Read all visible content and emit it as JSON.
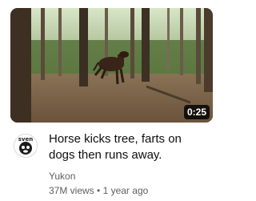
{
  "video": {
    "title": "Horse kicks tree, farts on dogs then runs away.",
    "duration": "0:25",
    "channel": "Yukon",
    "views": "37M views",
    "separator": "•",
    "age": "1 year ago"
  },
  "avatar": {
    "text": "sven"
  },
  "colors": {
    "title": "#0f0f0f",
    "secondary_text": "#606060",
    "duration_bg": "#000000"
  }
}
